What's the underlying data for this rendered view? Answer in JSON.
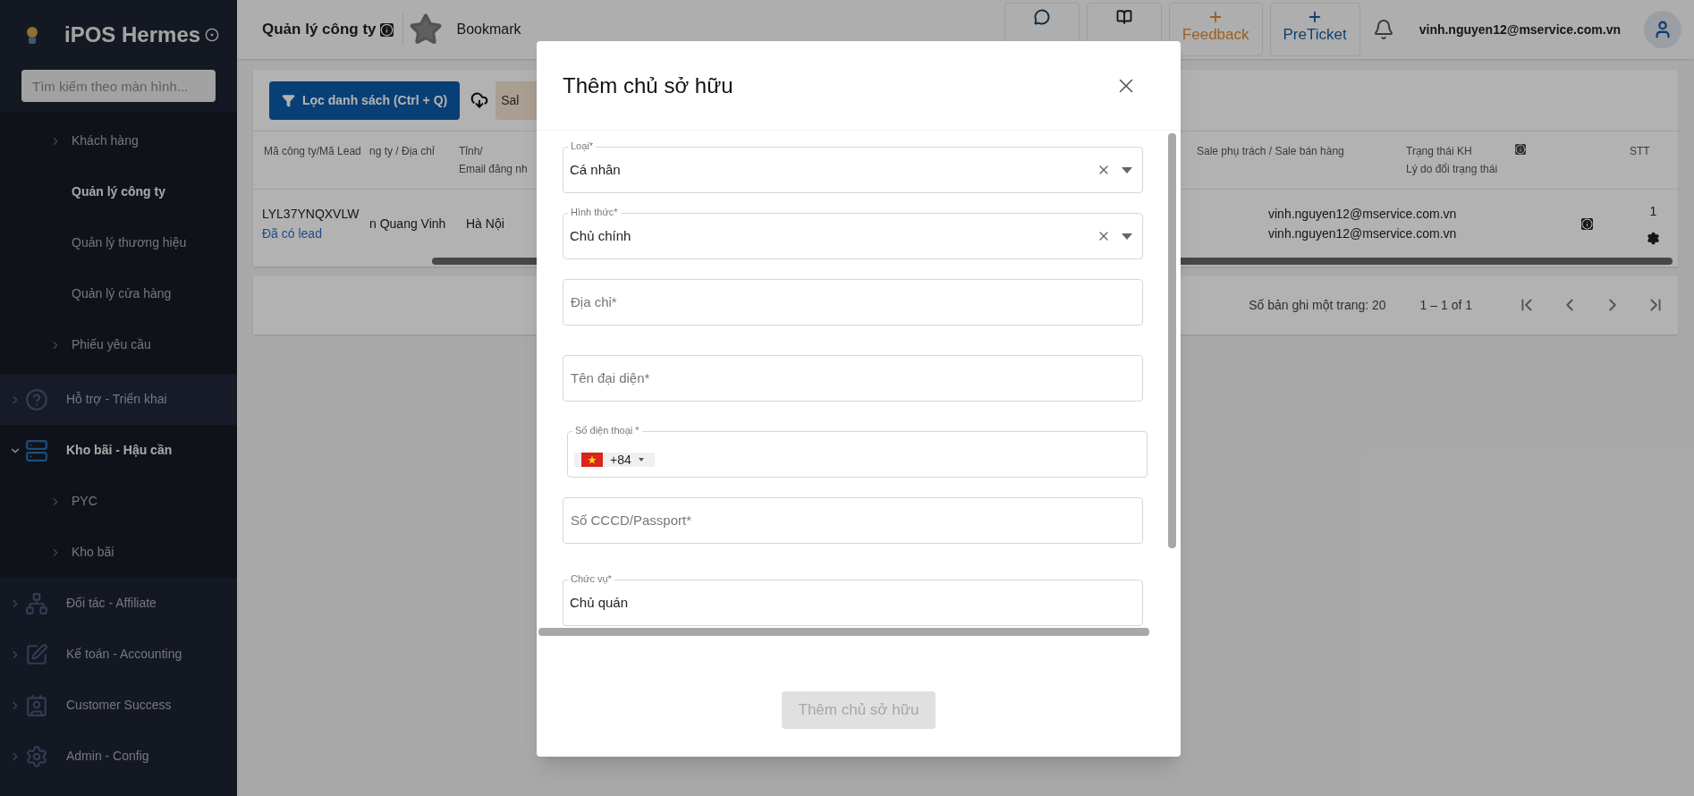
{
  "sidebar": {
    "app_name": "iPOS Hermes",
    "search": {
      "placeholder": "Tìm kiếm theo màn hình..."
    },
    "open_group_items": [
      {
        "label": "Khách hàng",
        "expandable": true,
        "selected": false
      },
      {
        "label": "Quản lý công ty",
        "expandable": false,
        "selected": true
      },
      {
        "label": "Quản lý thương hiệu",
        "expandable": false,
        "selected": false
      },
      {
        "label": "Quản lý cửa hàng",
        "expandable": false,
        "selected": false
      },
      {
        "label": "Phiếu yêu cầu",
        "expandable": true,
        "selected": false
      }
    ],
    "items": [
      {
        "label": "Hỗ trợ - Triển khai",
        "expanded": false
      },
      {
        "label": "Kho bãi - Hậu cần",
        "expanded": true,
        "children": [
          {
            "label": "PYC"
          },
          {
            "label": "Kho bãi"
          }
        ]
      },
      {
        "label": "Đối tác - Affiliate",
        "expanded": false
      },
      {
        "label": "Kế toán - Accounting",
        "expanded": false
      },
      {
        "label": "Customer Success",
        "expanded": false
      },
      {
        "label": "Admin - Config",
        "expanded": false
      }
    ]
  },
  "header": {
    "title": "Quản lý công ty",
    "bookmark": "Bookmark",
    "buttons": [
      {
        "kind": "chat"
      },
      {
        "kind": "book"
      },
      {
        "kind": "feedback",
        "label": "Feedback"
      },
      {
        "kind": "ticket",
        "label": "PreTicket"
      }
    ],
    "user_email": "vinh.nguyen12@mservice.com.vn"
  },
  "toolbar": {
    "filter_button": "Lọc danh sách (Ctrl + Q)",
    "chip": "Sal"
  },
  "table": {
    "columns_left": [
      [
        "Mã công ty/Mã Lead"
      ],
      [
        "ng ty / Địa chỉ"
      ],
      [
        "Tỉnh/",
        "Email đăng nh"
      ]
    ],
    "columns_right": [
      [
        "Sale phụ trách / Sale bán hàng"
      ],
      [
        "Trạng thái KH",
        "Lý do đổi trạng thái"
      ],
      [
        "STT"
      ]
    ],
    "rows": [
      {
        "code": "LYL37YNQXVLW",
        "lead": "Đã có lead",
        "name": "n Quang Vinh",
        "province": "Hà Nội",
        "sales": [
          "vinh.nguyen12@mservice.com.vn",
          "vinh.nguyen12@mservice.com.vn"
        ],
        "index": "1"
      }
    ]
  },
  "pagination": {
    "page_size": "Số bản ghi một trang: 20",
    "range": "1 – 1 of 1"
  },
  "dialog": {
    "title": "Thêm chủ sở hữu",
    "fields": [
      {
        "kind": "select",
        "label": "Loại*",
        "value": "Cá nhân"
      },
      {
        "kind": "select",
        "label": "Hình thức*",
        "value": "Chủ chính"
      },
      {
        "kind": "text",
        "placeholder": "Địa chỉ*"
      },
      {
        "kind": "text",
        "placeholder": "Tên đại diện*"
      },
      {
        "kind": "phone",
        "label": "Số điện thoại *",
        "country_code": "+84"
      },
      {
        "kind": "text",
        "placeholder": "Số CCCD/Passport*"
      },
      {
        "kind": "text",
        "label": "Chức vụ*",
        "value": "Chủ quán"
      }
    ],
    "submit": {
      "label": "Thêm chủ sở hữu",
      "disabled": true
    }
  }
}
